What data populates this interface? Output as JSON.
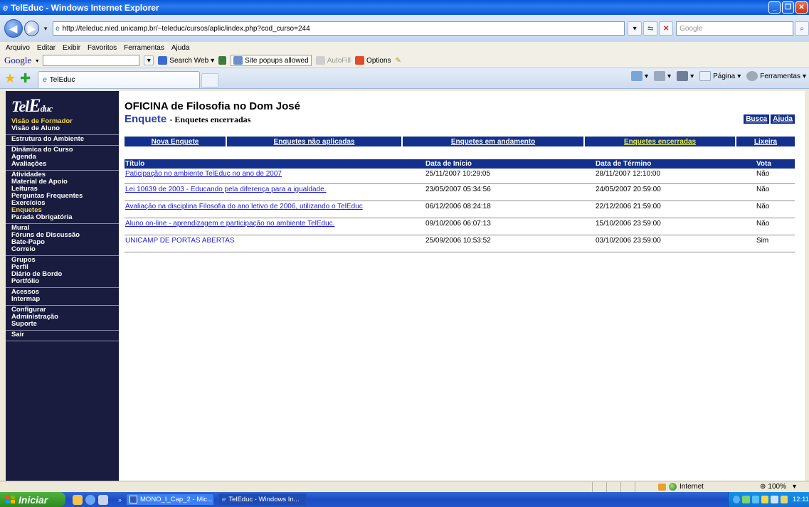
{
  "window": {
    "title": "TelEduc - Windows Internet Explorer"
  },
  "address": {
    "url": "http://teleduc.nied.unicamp.br/~teleduc/cursos/aplic/index.php?cod_curso=244",
    "search_placeholder": "Google"
  },
  "menu": {
    "items": [
      "Arquivo",
      "Editar",
      "Exibir",
      "Favoritos",
      "Ferramentas",
      "Ajuda"
    ]
  },
  "google_toolbar": {
    "logo": "Google",
    "search_web": "Search Web",
    "popups": "Site popups allowed",
    "autofill": "AutoFill",
    "options": "Options"
  },
  "tabs": {
    "current": "TelEduc"
  },
  "command_bar": {
    "page": "Página",
    "tools": "Ferramentas"
  },
  "sidebar": {
    "logo": "TelEduc",
    "groups": [
      {
        "items": [
          {
            "label": "Visão de Formador",
            "highlight": true
          },
          {
            "label": "Visão de Aluno",
            "highlight": false
          }
        ]
      },
      {
        "items": [
          {
            "label": "Estrutura do Ambiente",
            "highlight": false
          }
        ]
      },
      {
        "items": [
          {
            "label": "Dinâmica do Curso",
            "highlight": false
          },
          {
            "label": "Agenda",
            "highlight": false
          },
          {
            "label": "Avaliações",
            "highlight": false
          }
        ]
      },
      {
        "items": [
          {
            "label": "Atividades",
            "highlight": false
          },
          {
            "label": "Material de Apoio",
            "highlight": false
          },
          {
            "label": "Leituras",
            "highlight": false
          },
          {
            "label": "Perguntas Frequentes",
            "highlight": false
          },
          {
            "label": "Exercícios",
            "highlight": false
          },
          {
            "label": "Enquetes",
            "highlight": true
          },
          {
            "label": "Parada Obrigatória",
            "highlight": false
          }
        ]
      },
      {
        "items": [
          {
            "label": "Mural",
            "highlight": false
          },
          {
            "label": "Fóruns de Discussão",
            "highlight": false
          },
          {
            "label": "Bate-Papo",
            "highlight": false
          },
          {
            "label": "Correio",
            "highlight": false
          }
        ]
      },
      {
        "items": [
          {
            "label": "Grupos",
            "highlight": false
          },
          {
            "label": "Perfil",
            "highlight": false
          },
          {
            "label": "Diário de Bordo",
            "highlight": false
          },
          {
            "label": "Portfólio",
            "highlight": false
          }
        ]
      },
      {
        "items": [
          {
            "label": "Acessos",
            "highlight": false
          },
          {
            "label": "Intermap",
            "highlight": false
          }
        ]
      },
      {
        "items": [
          {
            "label": "Configurar",
            "highlight": false
          },
          {
            "label": "Administração",
            "highlight": false
          },
          {
            "label": "Suporte",
            "highlight": false
          }
        ]
      },
      {
        "items": [
          {
            "label": "Sair",
            "highlight": false
          }
        ]
      }
    ]
  },
  "main": {
    "course_title": "OFICINA de Filosofia no Dom José",
    "section": "Enquete",
    "subsection": "- Enquetes encerradas",
    "search_link": "Busca",
    "help_link": "Ajuda",
    "nav": [
      {
        "label": "Nova Enquete",
        "active": false
      },
      {
        "label": "Enquetes não aplicadas",
        "active": false
      },
      {
        "label": "Enquetes em andamento",
        "active": false
      },
      {
        "label": "Enquetes encerradas",
        "active": true
      },
      {
        "label": "Lixeira",
        "active": false
      }
    ],
    "table": {
      "headers": [
        "Título",
        "Data de Início",
        "Data de Término",
        "Vota"
      ],
      "rows": [
        {
          "title": "Paticipação no ambiente TelEduc no ano de 2007",
          "start": "25/11/2007 10:29:05",
          "end": "28/11/2007 12:10:00",
          "vote": "Não",
          "underline": true
        },
        {
          "title": "Lei 10639 de 2003 - Educando pela diferença para a igualdade.",
          "start": "23/05/2007 05:34:56",
          "end": "24/05/2007 20:59:00",
          "vote": "Não",
          "underline": true
        },
        {
          "title": "Avaliação na disciplina Filosofia do ano letivo de 2006, utilizando o TelEduc",
          "start": "06/12/2006 08:24:18",
          "end": "22/12/2006 21:59:00",
          "vote": "Não",
          "underline": true
        },
        {
          "title": "Aluno on-line - aprendizagem e participação no ambiente TelEduc.",
          "start": "09/10/2006 06:07:13",
          "end": "15/10/2006 23:59:00",
          "vote": "Não",
          "underline": true
        },
        {
          "title": "UNICAMP DE PORTAS ABERTAS",
          "start": "25/09/2006 10:53:52",
          "end": "03/10/2006 23:59:00",
          "vote": "Sim",
          "underline": false
        }
      ]
    }
  },
  "status": {
    "zone": "Internet",
    "zoom": "100%"
  },
  "taskbar": {
    "start": "Iniciar",
    "tasks": [
      "MONO_I_Cap_2 - Mic...",
      "TelEduc - Windows In..."
    ],
    "clock": "12:11"
  }
}
